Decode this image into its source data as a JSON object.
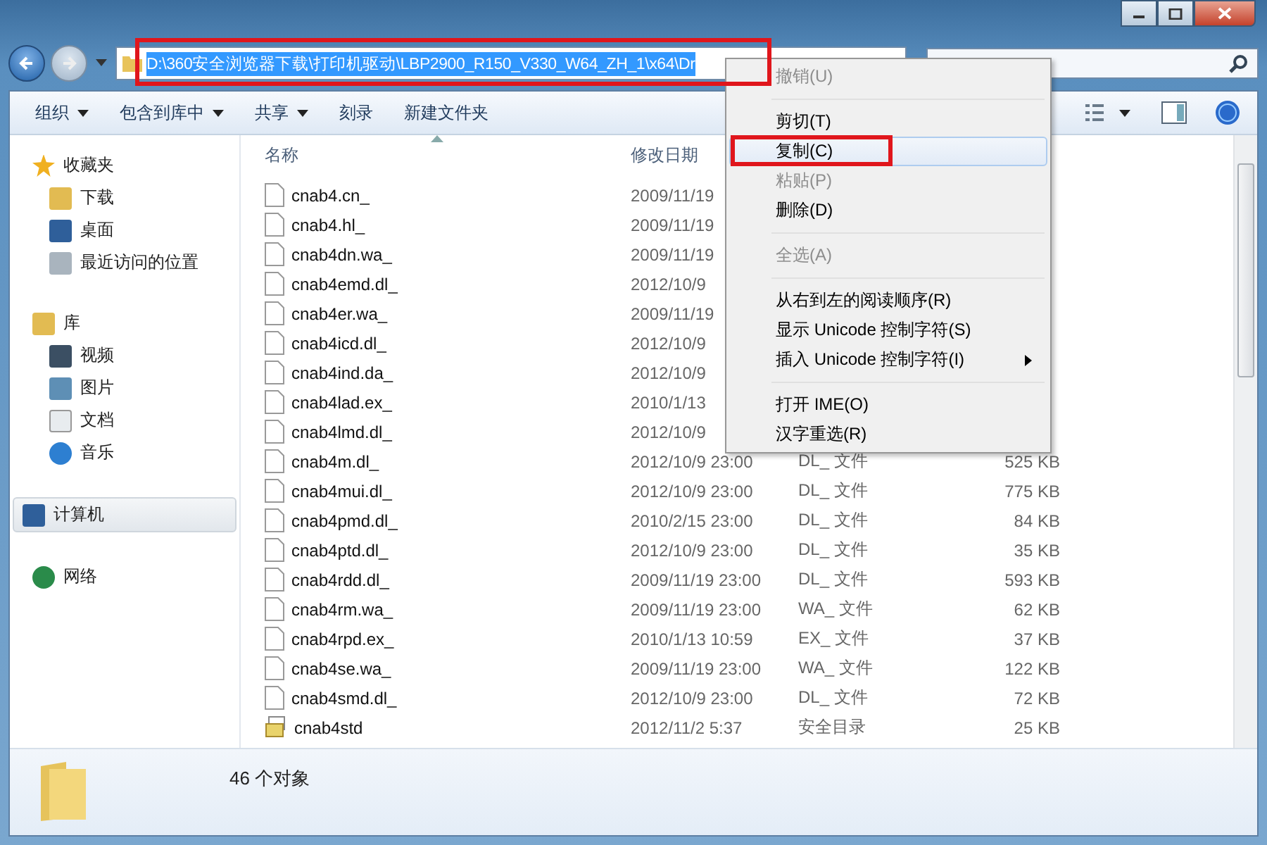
{
  "address": {
    "value": "D:\\360安全浏览器下载\\打印机驱动\\LBP2900_R150_V330_W64_ZH_1\\x64\\Dr",
    "selected": true
  },
  "toolbar": [
    {
      "label": "组织",
      "dropdown": true
    },
    {
      "label": "包含到库中",
      "dropdown": true
    },
    {
      "label": "共享",
      "dropdown": true
    },
    {
      "label": "刻录",
      "dropdown": false
    },
    {
      "label": "新建文件夹",
      "dropdown": false
    }
  ],
  "sidebar": {
    "items": [
      {
        "label": "收藏夹",
        "selected": false,
        "children": [
          {
            "label": "下载",
            "selected": false
          },
          {
            "label": "桌面",
            "selected": false
          },
          {
            "label": "最近访问的位置",
            "selected": false
          }
        ]
      },
      {
        "label": "库",
        "selected": false,
        "children": [
          {
            "label": "视频",
            "selected": false
          },
          {
            "label": "图片",
            "selected": false
          },
          {
            "label": "文档",
            "selected": false
          },
          {
            "label": "音乐",
            "selected": false
          }
        ]
      },
      {
        "label": "计算机",
        "selected": true
      },
      {
        "label": "网络",
        "selected": false
      }
    ]
  },
  "table": {
    "columns": [
      "名称",
      "修改日期"
    ],
    "rows": [
      {
        "name": "cnab4.cn_",
        "date": "2009/11/19",
        "kind": "file"
      },
      {
        "name": "cnab4.hl_",
        "date": "2009/11/19",
        "kind": "file"
      },
      {
        "name": "cnab4dn.wa_",
        "date": "2009/11/19",
        "kind": "file"
      },
      {
        "name": "cnab4emd.dl_",
        "date": "2012/10/9",
        "kind": "file"
      },
      {
        "name": "cnab4er.wa_",
        "date": "2009/11/19",
        "kind": "file"
      },
      {
        "name": "cnab4icd.dl_",
        "date": "2012/10/9",
        "kind": "file"
      },
      {
        "name": "cnab4ind.da_",
        "date": "2012/10/9",
        "kind": "file"
      },
      {
        "name": "cnab4lad.ex_",
        "date": "2010/1/13",
        "kind": "file"
      },
      {
        "name": "cnab4lmd.dl_",
        "date": "2012/10/9",
        "kind": "file"
      },
      {
        "name": "cnab4m.dl_",
        "date": "2012/10/9 23:00",
        "type": "DL_ 文件",
        "size": "525 KB",
        "kind": "file"
      },
      {
        "name": "cnab4mui.dl_",
        "date": "2012/10/9 23:00",
        "type": "DL_ 文件",
        "size": "775 KB",
        "kind": "file"
      },
      {
        "name": "cnab4pmd.dl_",
        "date": "2010/2/15 23:00",
        "type": "DL_ 文件",
        "size": "84 KB",
        "kind": "file"
      },
      {
        "name": "cnab4ptd.dl_",
        "date": "2012/10/9 23:00",
        "type": "DL_ 文件",
        "size": "35 KB",
        "kind": "file"
      },
      {
        "name": "cnab4rdd.dl_",
        "date": "2009/11/19 23:00",
        "type": "DL_ 文件",
        "size": "593 KB",
        "kind": "file"
      },
      {
        "name": "cnab4rm.wa_",
        "date": "2009/11/19 23:00",
        "type": "WA_ 文件",
        "size": "62 KB",
        "kind": "file"
      },
      {
        "name": "cnab4rpd.ex_",
        "date": "2010/1/13 10:59",
        "type": "EX_ 文件",
        "size": "37 KB",
        "kind": "file"
      },
      {
        "name": "cnab4se.wa_",
        "date": "2009/11/19 23:00",
        "type": "WA_ 文件",
        "size": "122 KB",
        "kind": "file"
      },
      {
        "name": "cnab4smd.dl_",
        "date": "2012/10/9 23:00",
        "type": "DL_ 文件",
        "size": "72 KB",
        "kind": "file"
      },
      {
        "name": "cnab4std",
        "date": "2012/11/2 5:37",
        "type": "安全目录",
        "size": "25 KB",
        "kind": "catalog"
      }
    ]
  },
  "context_menu": [
    {
      "kind": "item",
      "label": "撤销(U)",
      "disabled": true,
      "selected": false
    },
    {
      "kind": "separator"
    },
    {
      "kind": "item",
      "label": "剪切(T)",
      "disabled": false,
      "selected": false
    },
    {
      "kind": "item",
      "label": "复制(C)",
      "disabled": false,
      "selected": true
    },
    {
      "kind": "item",
      "label": "粘贴(P)",
      "disabled": true,
      "selected": false
    },
    {
      "kind": "item",
      "label": "删除(D)",
      "disabled": false,
      "selected": false
    },
    {
      "kind": "separator"
    },
    {
      "kind": "item",
      "label": "全选(A)",
      "disabled": true,
      "selected": false
    },
    {
      "kind": "separator"
    },
    {
      "kind": "item",
      "label": "从右到左的阅读顺序(R)",
      "disabled": false,
      "selected": false
    },
    {
      "kind": "item",
      "label": "显示 Unicode 控制字符(S)",
      "disabled": false,
      "selected": false
    },
    {
      "kind": "item",
      "label": "插入 Unicode 控制字符(I)",
      "disabled": false,
      "selected": false,
      "submenu": true
    },
    {
      "kind": "separator"
    },
    {
      "kind": "item",
      "label": "打开 IME(O)",
      "disabled": false,
      "selected": false
    },
    {
      "kind": "item",
      "label": "汉字重选(R)",
      "disabled": false,
      "selected": false
    }
  ],
  "status_bar": {
    "count": "46 个对象"
  }
}
